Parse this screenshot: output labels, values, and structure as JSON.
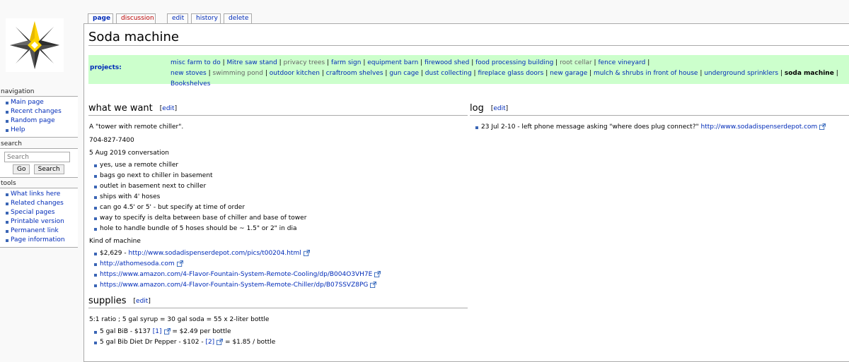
{
  "sidebar": {
    "navigation": {
      "heading": "navigation",
      "items": [
        "Main page",
        "Recent changes",
        "Random page",
        "Help"
      ]
    },
    "search": {
      "heading": "search",
      "placeholder": "Search",
      "go_label": "Go",
      "search_label": "Search"
    },
    "tools": {
      "heading": "tools",
      "items": [
        "What links here",
        "Related changes",
        "Special pages",
        "Printable version",
        "Permanent link",
        "Page information"
      ]
    }
  },
  "tabs": {
    "page": "page",
    "discussion": "discussion",
    "edit": "edit",
    "history": "history",
    "delete": "delete"
  },
  "title": "Soda machine",
  "projects": {
    "label": "projects:",
    "links": [
      "misc farm to do",
      "Mitre saw stand",
      "privacy trees",
      "farm sign",
      "equipment barn",
      "firewood shed",
      "food processing building",
      "root cellar",
      "fence vineyard",
      "new stoves",
      "swimming pond",
      "outdoor kitchen",
      "craftroom shelves",
      "gun cage",
      "dust collecting",
      "fireplace glass doors",
      "new garage",
      "mulch & shrubs in front of house",
      "underground sprinklers",
      "soda machine",
      "Bookshelves"
    ]
  },
  "sections": {
    "edit_label": "edit",
    "what_we_want": {
      "heading": "what we want",
      "intro": "A \"tower with remote chiller\".",
      "phone": "704-827-7400",
      "conversation": "5 Aug 2019 conversation",
      "notes": [
        "yes, use a remote chiller",
        "bags go next to chiller in basement",
        "outlet in basement next to chiller",
        "ships with 4' hoses",
        "can go 4.5' or 5' - but specify at time of order",
        "way to specify is delta between base of chiller and base of tower",
        "hole to handle bundle of 5 hoses should be ~ 1.5\" or 2\" in dia"
      ],
      "kind_heading": "Kind of machine",
      "machine_price": "$2,629 - ",
      "machine_link": "http://www.sodadispenserdepot.com/pics/t00204.html",
      "links": [
        "http://athomesoda.com",
        "https://www.amazon.com/4-Flavor-Fountain-System-Remote-Cooling/dp/B004O3VH7E",
        "https://www.amazon.com/4-Flavor-Fountain-System-Remote-Chiller/dp/B07SSVZ8PG"
      ]
    },
    "supplies": {
      "heading": "supplies",
      "ratio": "5:1 ratio ; 5 gal syrup = 30 gal soda = 55 x 2-liter bottle",
      "item1_text": "5 gal BiB - $137 ",
      "item1_ref": "[1]",
      "item1_after": " = $2.49 per bottle",
      "item2_text": "5 gal Bib Diet Dr Pepper - $102 - ",
      "item2_ref": "[2]",
      "item2_after": " = $1.85 / bottle"
    },
    "log": {
      "heading": "log",
      "entry_text": "23 Jul 2-10 - left phone message asking \"where does plug connect?\" ",
      "entry_link": "http://www.sodadispenserdepot.com"
    }
  },
  "colors": {
    "link": "#002bb8",
    "new_link": "#ba0000",
    "projects_bg": "#ccffcc"
  }
}
